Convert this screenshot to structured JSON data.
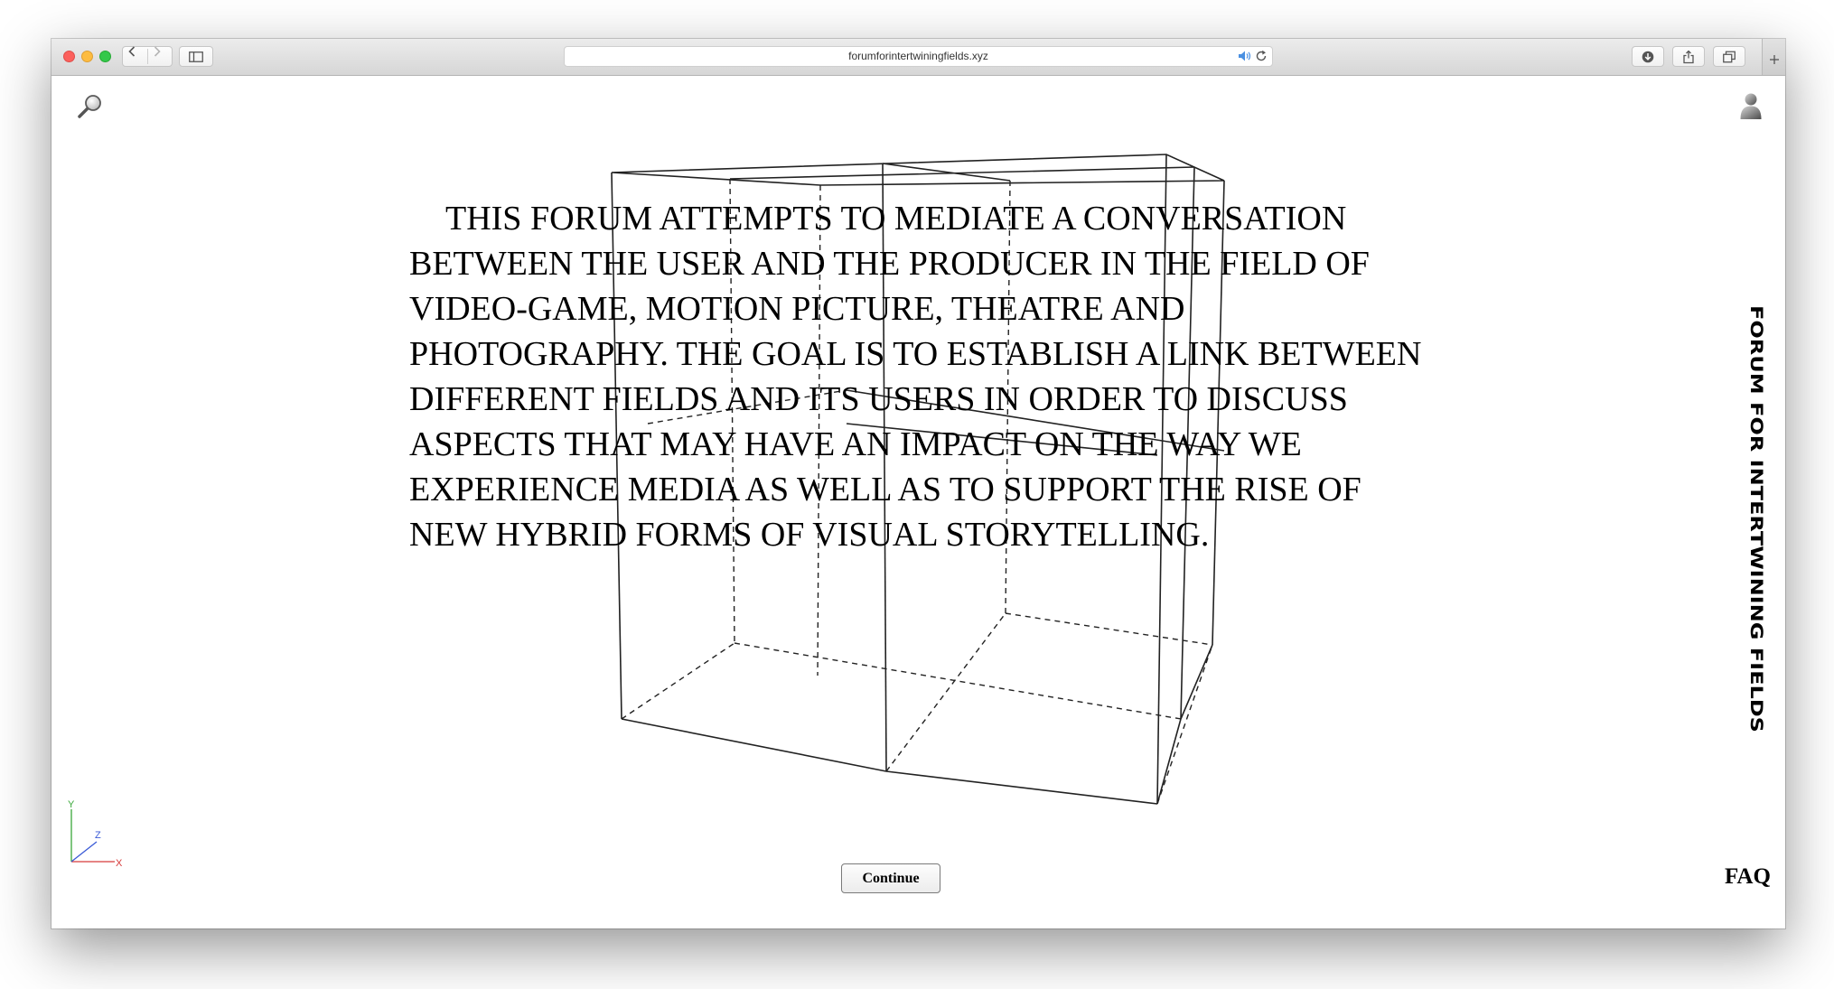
{
  "browser": {
    "url": "forumforintertwiningfields.xyz",
    "icons": {
      "back": "chevron-left-icon",
      "forward": "chevron-right-icon",
      "sidebar": "sidebar-icon",
      "audio": "speaker-icon",
      "reload": "reload-icon",
      "download": "download-icon",
      "share": "share-icon",
      "tabs": "tabs-overview-icon",
      "new_tab": "plus-icon"
    },
    "traffic_light_colors": {
      "close": "#fc605c",
      "minimize": "#fdbc40",
      "zoom": "#34c84a"
    }
  },
  "page": {
    "icons": {
      "search": "magnifier-icon",
      "account": "user-icon",
      "scene": "wireframe-cube",
      "axes": "axis-gizmo-icon"
    },
    "intro": "THIS FORUM ATTEMPTS TO MEDIATE A CONVERSATION BETWEEN THE USER AND THE PRODUCER IN THE FIELD OF VIDEO-GAME, MOTION PICTURE, THEATRE AND PHOTOGRAPHY. THE GOAL IS TO ESTABLISH A LINK BETWEEN DIFFERENT FIELDS AND ITS USERS IN ORDER TO DISCUSS  ASPECTS THAT MAY HAVE AN IMPACT ON THE WAY WE EXPERIENCE MEDIA AS WELL AS TO SUPPORT THE RISE OF NEW HYBRID FORMS OF VISUAL STORYTELLING.",
    "vertical_title": "FORUM FOR INTERTWINING FIELDS",
    "axis_labels": {
      "x": "X",
      "y": "Y",
      "z": "Z"
    },
    "axis_colors": {
      "x": "#d63a3a",
      "y": "#3aa83a",
      "z": "#3a5ad6"
    },
    "continue_label": "Continue",
    "faq_label": "FAQ"
  }
}
